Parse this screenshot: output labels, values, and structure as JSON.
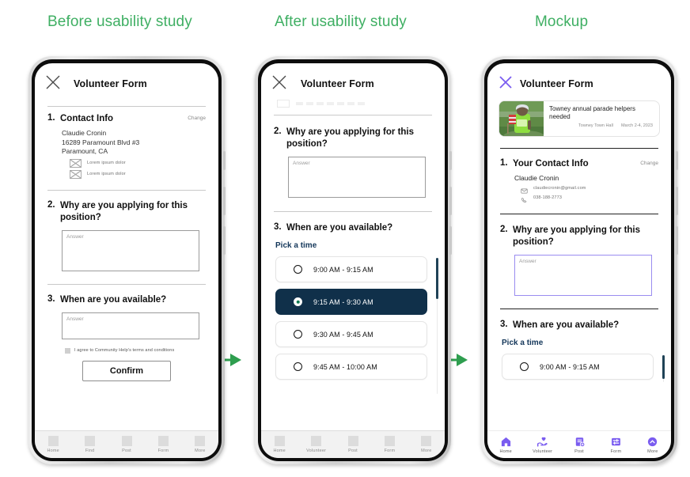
{
  "columns": [
    {
      "title": "Before usability study"
    },
    {
      "title": "After usability study"
    },
    {
      "title": "Mockup"
    }
  ],
  "arrows": [
    {
      "name": "flow-arrow-1",
      "glyph": "→"
    },
    {
      "name": "flow-arrow-2",
      "glyph": "→"
    }
  ],
  "phone1": {
    "appbar": {
      "title": "Volunteer Form",
      "close_icon": "close-x-icon"
    },
    "q1": {
      "number": "1.",
      "title": "Contact Info",
      "change": "Change",
      "address_line1": "Claudie Cronin",
      "address_line2": "16289 Paramount Blvd #3",
      "address_line3": "Paramount, CA",
      "lorem_items": [
        {
          "label": "Lorem ipsum dolor"
        },
        {
          "label": "Lorem ipsum dolor"
        }
      ]
    },
    "q2": {
      "number": "2.",
      "title": "Why are you applying for this position?",
      "answer_placeholder": "Answer"
    },
    "q3": {
      "number": "3.",
      "title": "When are you available?",
      "answer_placeholder": "Answer"
    },
    "terms_label": "I agree to Community Help's terms and conditions",
    "confirm_label": "Confirm",
    "tabs": [
      {
        "label": "Home"
      },
      {
        "label": "Find"
      },
      {
        "label": "Post"
      },
      {
        "label": "Form"
      },
      {
        "label": "More"
      }
    ]
  },
  "phone2": {
    "appbar": {
      "title": "Volunteer Form",
      "close_icon": "close-x-icon"
    },
    "q2": {
      "number": "2.",
      "title": "Why are you applying for this position?",
      "answer_placeholder": "Answer"
    },
    "q3": {
      "number": "3.",
      "title": "When are you available?",
      "pick_a_time": "Pick a time"
    },
    "slots": [
      {
        "label": "9:00 AM - 9:15 AM",
        "selected": false
      },
      {
        "label": "9:15 AM - 9:30 AM",
        "selected": true
      },
      {
        "label": "9:30 AM - 9:45 AM",
        "selected": false
      },
      {
        "label": "9:45 AM - 10:00 AM",
        "selected": false
      }
    ],
    "tabs": [
      {
        "label": "Home"
      },
      {
        "label": "Volunteer"
      },
      {
        "label": "Post"
      },
      {
        "label": "Form"
      },
      {
        "label": "More"
      }
    ]
  },
  "phone3": {
    "appbar": {
      "title": "Volunteer Form",
      "close_icon": "close-x-icon"
    },
    "event_card": {
      "title": "Towney annual parade helpers needed",
      "venue": "Towney Town Hall",
      "dates": "March 2-4, 2023"
    },
    "q1": {
      "number": "1.",
      "title": "Your Contact Info",
      "change": "Change",
      "name": "Claudie Cronin",
      "email": "claudiecronin@gmail.com",
      "phone": "038-188-2773",
      "email_icon": "envelope-icon",
      "phone_icon": "phone-icon"
    },
    "q2": {
      "number": "2.",
      "title": "Why are you applying for this position?",
      "answer_placeholder": "Answer"
    },
    "q3": {
      "number": "3.",
      "title": "When are you available?",
      "pick_a_time": "Pick a time"
    },
    "slots": [
      {
        "label": "9:00 AM - 9:15 AM",
        "selected": false
      }
    ],
    "tabs": [
      {
        "label": "Home",
        "icon": "home-icon"
      },
      {
        "label": "Volunteer",
        "icon": "volunteer-hand-heart-icon"
      },
      {
        "label": "Post",
        "icon": "post-add-icon"
      },
      {
        "label": "Form",
        "icon": "form-icon"
      },
      {
        "label": "More",
        "icon": "chevron-up-circle-icon"
      }
    ]
  },
  "colors": {
    "heading_green": "#3faf63",
    "arrow_green": "#2e9e4f",
    "selected_slot_bg": "#10304a",
    "radio_dot_green": "#0f7a52",
    "mockup_accent_purple": "#7a5cf0",
    "pick_time_navy": "#14375a"
  }
}
